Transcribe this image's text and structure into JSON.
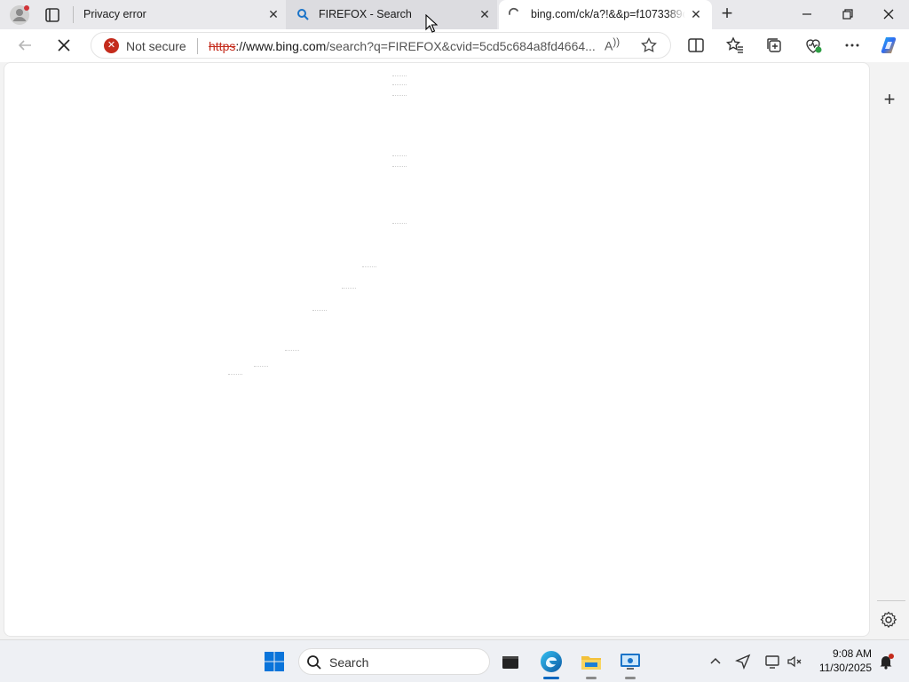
{
  "tabs": [
    {
      "title": "Privacy error",
      "close": "✕"
    },
    {
      "title": "FIREFOX - Search",
      "close": "✕"
    },
    {
      "title": "bing.com/ck/a?!&&p=f1073389c",
      "close": "✕"
    }
  ],
  "newtab_label": "+",
  "window_controls": {
    "minimize": "—",
    "maximize": "❐",
    "close": "✕"
  },
  "address": {
    "security_label": "Not secure",
    "url_scheme": "https",
    "url_rest_host": "://www.bing.com",
    "url_path": "/search?q=FIREFOX&cvid=5cd5c684a8fd4664..."
  },
  "read_aloud_label": "A",
  "sidebar": {
    "add_label": "+"
  },
  "taskbar": {
    "search_label": "Search",
    "time": "9:08 AM",
    "date": "11/30/2025"
  },
  "icons": {
    "profile": "profile-icon",
    "tab-actions": "tab-actions-icon",
    "back": "back-arrow-icon",
    "stop": "stop-loading-icon",
    "split": "split-screen-icon",
    "favorites": "favorites-icon",
    "collections": "collections-icon",
    "performance": "browser-essentials-icon",
    "more": "more-icon",
    "copilot": "copilot-icon",
    "settings": "settings-gear-icon"
  },
  "colors": {
    "insecure": "#c42b1c",
    "accent": "#0067c0"
  }
}
